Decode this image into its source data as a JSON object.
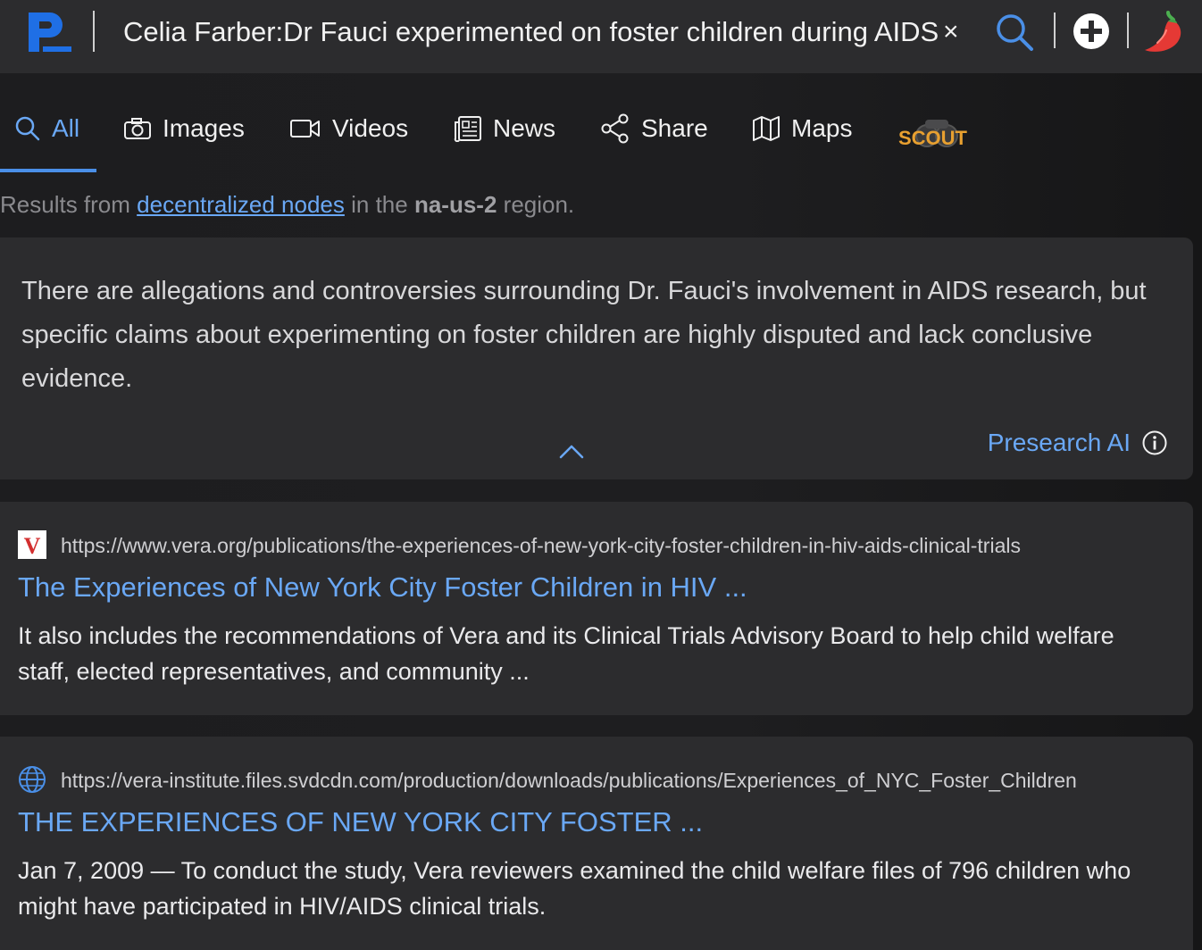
{
  "header": {
    "query": "Celia Farber:Dr Fauci experimented on foster children during AIDS",
    "clear_label": "×"
  },
  "tabs": [
    {
      "label": "All",
      "icon": "search-icon",
      "active": true
    },
    {
      "label": "Images",
      "icon": "camera-icon"
    },
    {
      "label": "Videos",
      "icon": "video-icon"
    },
    {
      "label": "News",
      "icon": "newspaper-icon"
    },
    {
      "label": "Share",
      "icon": "share-icon"
    },
    {
      "label": "Maps",
      "icon": "map-icon"
    }
  ],
  "scout_label": "SCOUT",
  "region": {
    "prefix": "Results from",
    "link": "decentralized nodes",
    "middle": "in the",
    "name": "na-us-2",
    "suffix": "region."
  },
  "ai_summary": {
    "text": "There are allegations and controversies surrounding Dr. Fauci's involvement in AIDS research, but specific claims about experimenting on foster children are highly disputed and lack conclusive evidence.",
    "brand": "Presearch AI"
  },
  "results": [
    {
      "favicon": "V",
      "url": "https://www.vera.org/publications/the-experiences-of-new-york-city-foster-children-in-hiv-aids-clinical-trials",
      "title": "The Experiences of New York City Foster Children in HIV ...",
      "snippet": "It also includes the recommendations of Vera and its Clinical Trials Advisory Board to help child welfare staff, elected representatives, and community ..."
    },
    {
      "favicon": "globe-icon",
      "url": "https://vera-institute.files.svdcdn.com/production/downloads/publications/Experiences_of_NYC_Foster_Children",
      "title": "THE EXPERIENCES OF NEW YORK CITY FOSTER ...",
      "snippet": "Jan 7, 2009 — To conduct the study, Vera reviewers examined the child welfare files of 796 children who might have participated in HIV/AIDS clinical trials."
    }
  ],
  "colors": {
    "accent": "#6aa8f5",
    "brand_blue": "#1f6fe5",
    "card_bg": "#2c2c2e"
  }
}
